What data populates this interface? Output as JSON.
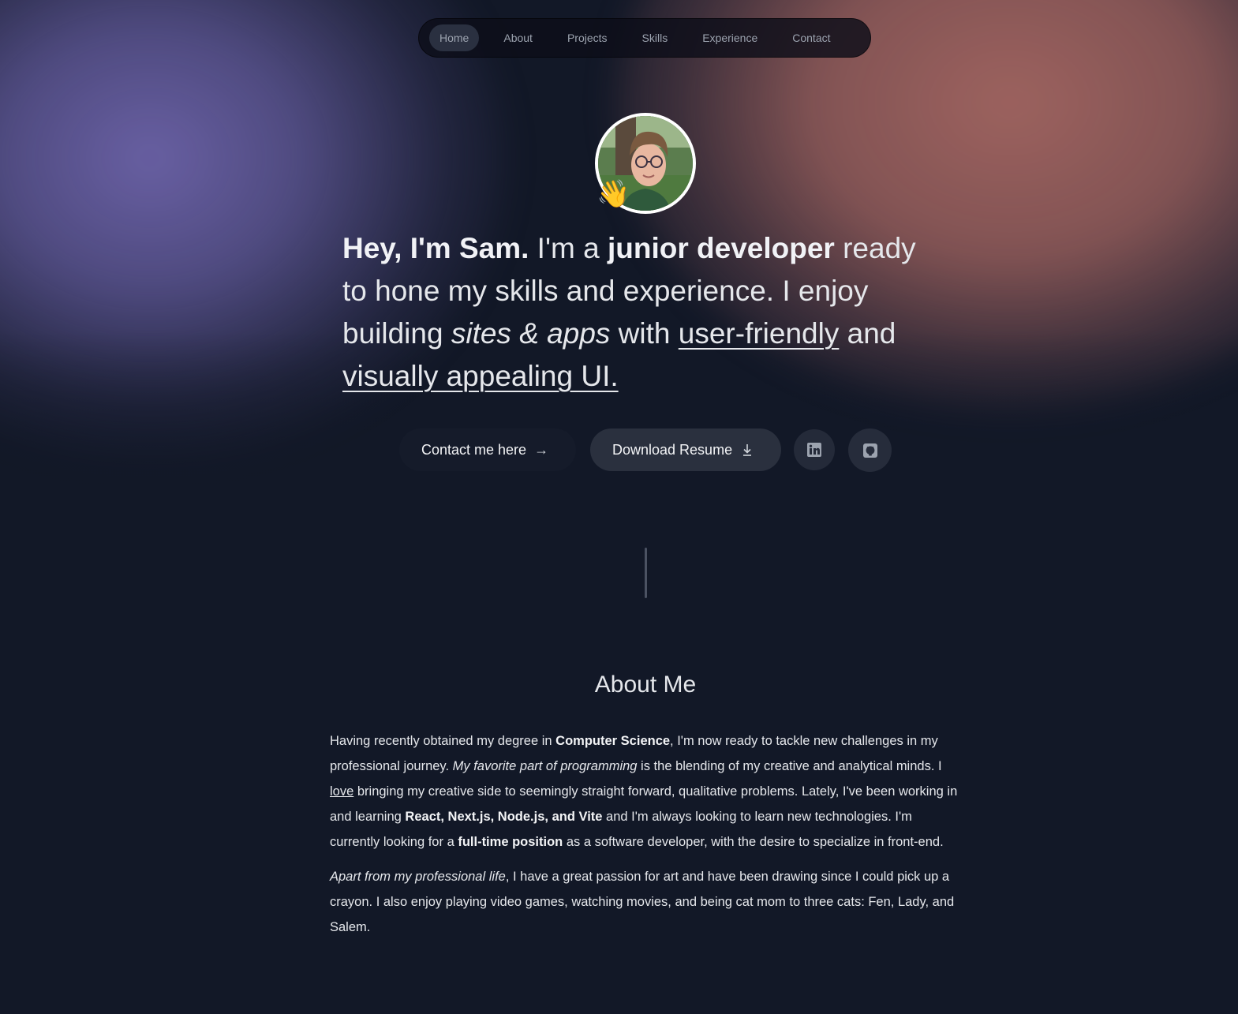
{
  "nav": {
    "items": [
      {
        "label": "Home",
        "active": true
      },
      {
        "label": "About"
      },
      {
        "label": "Projects"
      },
      {
        "label": "Skills"
      },
      {
        "label": "Experience"
      },
      {
        "label": "Contact"
      }
    ]
  },
  "hero": {
    "wave_emoji": "👋",
    "headline": {
      "greeting": "Hey, I'm Sam.",
      "t1": " I'm a ",
      "role": "junior developer",
      "t2": " ready to hone my skills and experience. I enjoy building ",
      "italic": "sites & apps",
      "t3": " with ",
      "u1": "user-friendly",
      "t4": " and ",
      "u2": "visually appealing UI."
    },
    "contact_button": "Contact me here",
    "contact_arrow": "→",
    "resume_button": "Download Resume"
  },
  "about": {
    "title": "About Me",
    "p1": {
      "a": "Having recently obtained my degree in ",
      "b": "Computer Science",
      "c": ", I'm now ready to tackle new challenges in my professional journey. ",
      "d": "My favorite part of programming",
      "e": " is the blending of my creative and analytical minds. I ",
      "f": "love",
      "g": " bringing my creative side to seemingly straight forward, qualitative problems. Lately, I've been working in and learning ",
      "h": "React, Next.js, Node.js, and Vite",
      "i": " and I'm always looking to learn new technologies. I'm currently looking for a ",
      "j": "full-time position",
      "k": " as a software developer, with the desire to specialize in front-end."
    },
    "p2": {
      "a": "Apart from my professional life",
      "b": ", I have a great passion for art and have been drawing since I could pick up a crayon. I also enjoy playing video games, watching movies, and being cat mom to three cats: Fen, Lady, and Salem."
    }
  },
  "icons": {
    "linkedin": "linkedin-icon",
    "github": "github-icon",
    "download": "download-icon"
  }
}
